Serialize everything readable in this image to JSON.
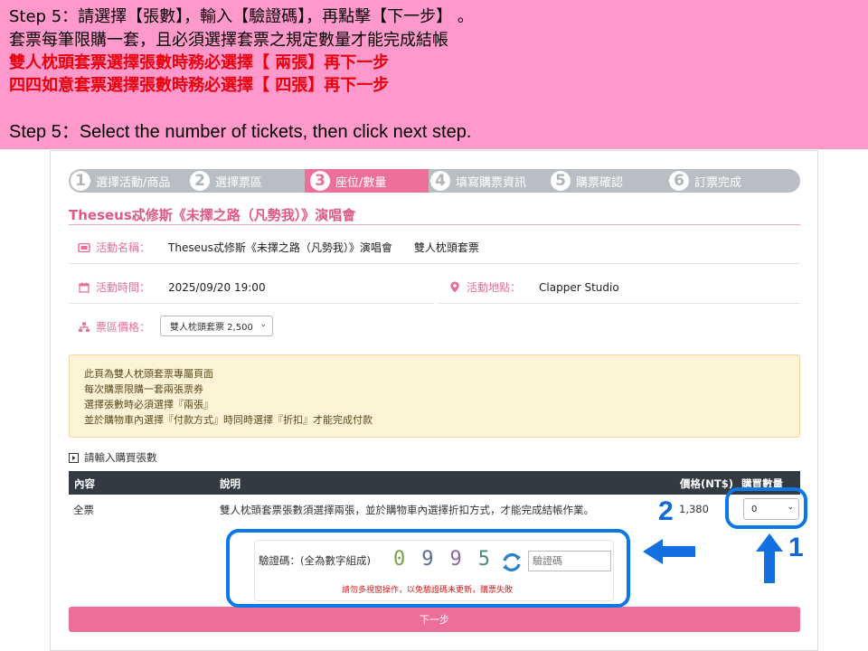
{
  "banner": {
    "line1": "Step 5：請選擇【張數】，輸入【驗證碼】，再點擊【下一步】  。",
    "line2": "套票每筆限購一套，且必須選擇套票之規定數量才能完成結帳",
    "line3": "雙人枕頭套票選擇張數時務必選擇【 兩張】再下一步",
    "line4": "四四如意套票選擇張數時務必選擇【 四張】再下一步",
    "line5": "Step 5：Select the number of tickets, then click next step.",
    "accent_color": "#e8000b",
    "background_color": "#ff99cc"
  },
  "steps": [
    {
      "num": "1",
      "label": "選擇活動/商品"
    },
    {
      "num": "2",
      "label": "選擇票區"
    },
    {
      "num": "3",
      "label": "座位/數量"
    },
    {
      "num": "4",
      "label": "填寫購票資訊"
    },
    {
      "num": "5",
      "label": "購票確認"
    },
    {
      "num": "6",
      "label": "訂票完成"
    }
  ],
  "active_step": 3,
  "event_title": "Theseus忒修斯《未擇之路（凡勢我）》演唱會",
  "info": {
    "name_label": "活動名稱：",
    "name_value": "Theseus忒修斯《未擇之路（凡勢我）》演唱會　　雙人枕頭套票",
    "time_label": "活動時間：",
    "time_value": "2025/09/20 19:00",
    "venue_label": "活動地點：",
    "venue_value": "Clapper Studio",
    "price_label": "票區價格：",
    "price_selected": "雙人枕頭套票 2,500"
  },
  "notice_lines": [
    "此頁為雙人枕頭套票專屬頁面",
    "每次購票限購一套兩張票券",
    "選擇張數時必須選擇『兩張』",
    "並於購物車內選擇『付款方式』時同時選擇『折扣』才能完成付款"
  ],
  "section_head": "請輸入購買張數",
  "table": {
    "headers": [
      "內容",
      "說明",
      "價格(NT$)",
      "購買數量"
    ],
    "row": {
      "content": "全票",
      "desc": "雙人枕頭套票張數須選擇兩張，並於購物車內選擇折扣方式，才能完成結帳作業。",
      "price": "1,380",
      "qty": "0"
    }
  },
  "captcha": {
    "label": "驗證碼：(全為數字組成)",
    "digits": [
      "0",
      "9",
      "9",
      "5"
    ],
    "placeholder": "驗證碼",
    "warning": "請勿多視窗操作，以免驗證碼未更新，購票失敗"
  },
  "next_button": "下一步",
  "annotations": {
    "num1": "1",
    "num2": "2",
    "color": "#0b78e8"
  },
  "icons": {
    "name": "ticket-icon",
    "time": "calendar-icon",
    "venue": "map-pin-icon",
    "price": "sitemap-icon",
    "section": "play-square-icon",
    "refresh": "refresh-icon"
  }
}
